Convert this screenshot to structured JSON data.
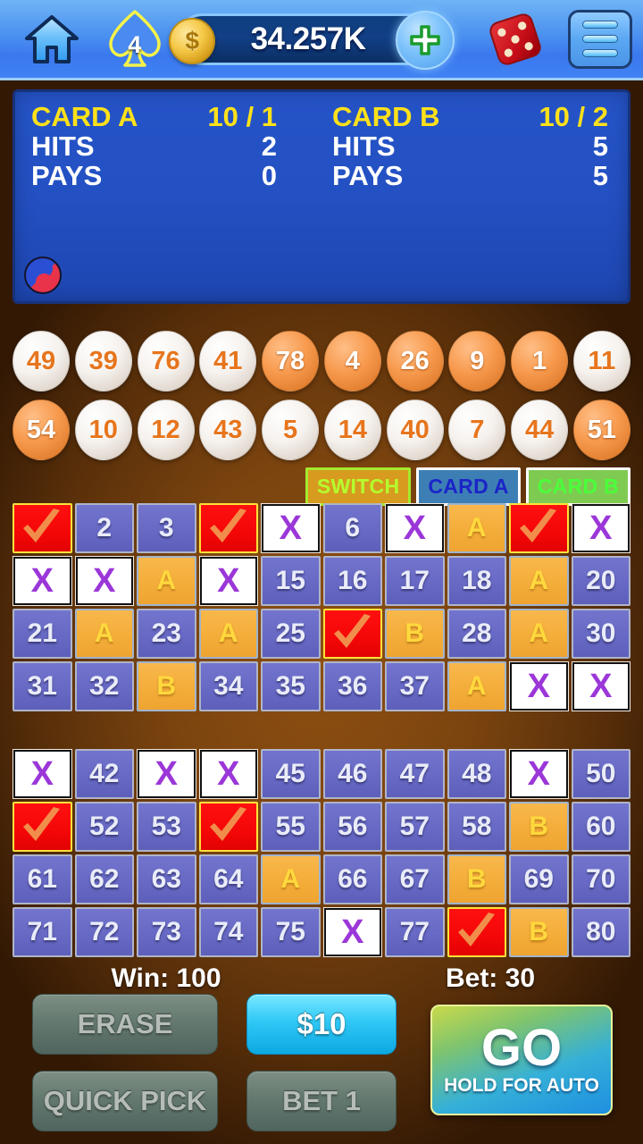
{
  "topbar": {
    "home_icon": "home-icon",
    "spade_icon": "spade-icon",
    "spade_count": "4",
    "coin_icon": "coin-icon",
    "coin_symbol": "$",
    "balance": "34.257K",
    "plus_icon": "plus-icon",
    "dice_icon": "dice-icon",
    "menu_icon": "hamburger-menu-icon"
  },
  "scoreboard": {
    "taegeuk_icon": "taegeuk-icon",
    "card_a": {
      "title": "CARD A",
      "ratio": "10 / 1",
      "hits_label": "HITS",
      "hits_value": "2",
      "pays_label": "PAYS",
      "pays_value": "0"
    },
    "card_b": {
      "title": "CARD B",
      "ratio": "10 / 2",
      "hits_label": "HITS",
      "hits_value": "5",
      "pays_label": "PAYS",
      "pays_value": "5"
    }
  },
  "drawn_balls": {
    "row1": [
      {
        "n": "49",
        "style": "white"
      },
      {
        "n": "39",
        "style": "white"
      },
      {
        "n": "76",
        "style": "white"
      },
      {
        "n": "41",
        "style": "white"
      },
      {
        "n": "78",
        "style": "orange"
      },
      {
        "n": "4",
        "style": "orange"
      },
      {
        "n": "26",
        "style": "orange"
      },
      {
        "n": "9",
        "style": "orange"
      },
      {
        "n": "1",
        "style": "orange"
      },
      {
        "n": "11",
        "style": "white"
      }
    ],
    "row2": [
      {
        "n": "54",
        "style": "orange"
      },
      {
        "n": "10",
        "style": "white"
      },
      {
        "n": "12",
        "style": "white"
      },
      {
        "n": "43",
        "style": "white"
      },
      {
        "n": "5",
        "style": "white"
      },
      {
        "n": "14",
        "style": "white"
      },
      {
        "n": "40",
        "style": "white"
      },
      {
        "n": "7",
        "style": "white"
      },
      {
        "n": "44",
        "style": "white"
      },
      {
        "n": "51",
        "style": "orange"
      }
    ]
  },
  "card_selector": {
    "switch_label": "SWITCH",
    "card_a_label": "CARD A",
    "card_b_label": "CARD B"
  },
  "grid_top": [
    {
      "n": "1",
      "state": "hit"
    },
    {
      "n": "2",
      "state": "num"
    },
    {
      "n": "3",
      "state": "num"
    },
    {
      "n": "4",
      "state": "hit"
    },
    {
      "n": "X",
      "state": "x"
    },
    {
      "n": "6",
      "state": "num"
    },
    {
      "n": "X",
      "state": "x"
    },
    {
      "n": "A",
      "state": "mark"
    },
    {
      "n": "9",
      "state": "hit"
    },
    {
      "n": "X",
      "state": "x"
    },
    {
      "n": "X",
      "state": "x"
    },
    {
      "n": "X",
      "state": "x"
    },
    {
      "n": "A",
      "state": "mark"
    },
    {
      "n": "X",
      "state": "x"
    },
    {
      "n": "15",
      "state": "num"
    },
    {
      "n": "16",
      "state": "num"
    },
    {
      "n": "17",
      "state": "num"
    },
    {
      "n": "18",
      "state": "num"
    },
    {
      "n": "A",
      "state": "mark"
    },
    {
      "n": "20",
      "state": "num"
    },
    {
      "n": "21",
      "state": "num"
    },
    {
      "n": "A",
      "state": "mark"
    },
    {
      "n": "23",
      "state": "num"
    },
    {
      "n": "A",
      "state": "mark"
    },
    {
      "n": "25",
      "state": "num"
    },
    {
      "n": "26",
      "state": "hit"
    },
    {
      "n": "B",
      "state": "mark"
    },
    {
      "n": "28",
      "state": "num"
    },
    {
      "n": "A",
      "state": "mark"
    },
    {
      "n": "30",
      "state": "num"
    },
    {
      "n": "31",
      "state": "num"
    },
    {
      "n": "32",
      "state": "num"
    },
    {
      "n": "B",
      "state": "mark"
    },
    {
      "n": "34",
      "state": "num"
    },
    {
      "n": "35",
      "state": "num"
    },
    {
      "n": "36",
      "state": "num"
    },
    {
      "n": "37",
      "state": "num"
    },
    {
      "n": "A",
      "state": "mark"
    },
    {
      "n": "X",
      "state": "x"
    },
    {
      "n": "X",
      "state": "x"
    }
  ],
  "grid_bottom": [
    {
      "n": "X",
      "state": "x"
    },
    {
      "n": "42",
      "state": "num"
    },
    {
      "n": "X",
      "state": "x"
    },
    {
      "n": "X",
      "state": "x"
    },
    {
      "n": "45",
      "state": "num"
    },
    {
      "n": "46",
      "state": "num"
    },
    {
      "n": "47",
      "state": "num"
    },
    {
      "n": "48",
      "state": "num"
    },
    {
      "n": "X",
      "state": "x"
    },
    {
      "n": "50",
      "state": "num"
    },
    {
      "n": "51",
      "state": "hit"
    },
    {
      "n": "52",
      "state": "num"
    },
    {
      "n": "53",
      "state": "num"
    },
    {
      "n": "54",
      "state": "hit"
    },
    {
      "n": "55",
      "state": "num"
    },
    {
      "n": "56",
      "state": "num"
    },
    {
      "n": "57",
      "state": "num"
    },
    {
      "n": "58",
      "state": "num"
    },
    {
      "n": "B",
      "state": "mark"
    },
    {
      "n": "60",
      "state": "num"
    },
    {
      "n": "61",
      "state": "num"
    },
    {
      "n": "62",
      "state": "num"
    },
    {
      "n": "63",
      "state": "num"
    },
    {
      "n": "64",
      "state": "num"
    },
    {
      "n": "A",
      "state": "mark"
    },
    {
      "n": "66",
      "state": "num"
    },
    {
      "n": "67",
      "state": "num"
    },
    {
      "n": "B",
      "state": "mark"
    },
    {
      "n": "69",
      "state": "num"
    },
    {
      "n": "70",
      "state": "num"
    },
    {
      "n": "71",
      "state": "num"
    },
    {
      "n": "72",
      "state": "num"
    },
    {
      "n": "73",
      "state": "num"
    },
    {
      "n": "74",
      "state": "num"
    },
    {
      "n": "75",
      "state": "num"
    },
    {
      "n": "X",
      "state": "x"
    },
    {
      "n": "77",
      "state": "num"
    },
    {
      "n": "78",
      "state": "hit"
    },
    {
      "n": "B",
      "state": "mark"
    },
    {
      "n": "80",
      "state": "num"
    }
  ],
  "footer": {
    "win_text": "Win: 100",
    "bet_text": "Bet: 30",
    "erase_label": "ERASE",
    "quick_pick_label": "QUICK PICK",
    "amount_label": "$10",
    "bet1_label": "BET 1",
    "go_label": "GO",
    "go_sub_label": "HOLD FOR AUTO"
  },
  "colors": {
    "topbar_blue": "#4d93f0",
    "scoreboard_blue": "#2350c2",
    "scoreboard_title_yellow": "#ffe11a",
    "felt_brown": "#8d4f11",
    "cell_purple": "#6769c4",
    "cell_mark_orange": "#f4ad3a",
    "cell_hit_red": "#f40707",
    "x_purple": "#9b37d8",
    "go_cyan": "#2fc8f6"
  }
}
